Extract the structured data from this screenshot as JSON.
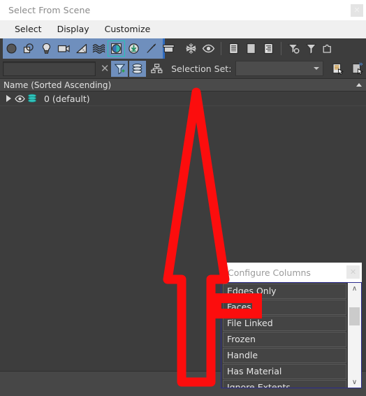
{
  "window": {
    "title": "Select From Scene",
    "close_label": "✕"
  },
  "menubar": {
    "items": [
      {
        "label": "Select"
      },
      {
        "label": "Display"
      },
      {
        "label": "Customize"
      }
    ]
  },
  "toolbar_primary": {
    "icons": [
      {
        "name": "geometry-icon",
        "selected": false
      },
      {
        "name": "shapes-icon",
        "selected": false
      },
      {
        "name": "lights-icon",
        "selected": false
      },
      {
        "name": "cameras-icon",
        "selected": false
      },
      {
        "name": "helpers-icon",
        "selected": false
      },
      {
        "name": "space-warps-icon",
        "selected": false
      },
      {
        "name": "groups-icon",
        "selected": true
      },
      {
        "name": "xrefs-icon",
        "selected": false
      },
      {
        "name": "bone-objects-icon",
        "selected": false
      },
      {
        "name": "containers-icon",
        "selected": false
      }
    ],
    "state_icons": [
      {
        "name": "frozen-icon"
      },
      {
        "name": "hidden-eye-icon"
      }
    ],
    "view_icons": [
      {
        "name": "display-children-icon"
      },
      {
        "name": "display-influences-icon"
      },
      {
        "name": "expand-all-icon"
      }
    ],
    "filter_icons": [
      {
        "name": "selection-filter-icon"
      },
      {
        "name": "filter-icon"
      },
      {
        "name": "container-filter-icon"
      }
    ]
  },
  "toolbar_secondary": {
    "search": {
      "value": "",
      "placeholder": ""
    },
    "clear_label": "✕",
    "find_filter_icon": "find-filter-icon",
    "layers_icon": "layers-icon",
    "hierarchy_icon": "hierarchy-icon",
    "selection_set_label": "Selection Set:",
    "selection_set_value": "",
    "save_set_icon": "save-selection-set-icon",
    "delete_set_icon": "delete-selection-set-icon",
    "overflow_label": "»"
  },
  "list_header": {
    "column_label": "Name (Sorted Ascending)",
    "sort_indicator": "sort-ascending-icon"
  },
  "scene_tree": {
    "rows": [
      {
        "expander": "expand-triangle-icon",
        "visibility_icon": "eye-icon",
        "layer_icon": "layer-icon",
        "label": "0 (default)"
      }
    ]
  },
  "configure_columns": {
    "title": "Configure Columns",
    "close_label": "✕",
    "items": [
      {
        "label": "Edges Only",
        "highlighted": false
      },
      {
        "label": "Faces",
        "highlighted": true
      },
      {
        "label": "File Linked",
        "highlighted": false
      },
      {
        "label": "Frozen",
        "highlighted": false
      },
      {
        "label": "Handle",
        "highlighted": false
      },
      {
        "label": "Has Material",
        "highlighted": false
      },
      {
        "label": "Ignore Extents",
        "highlighted": false
      }
    ],
    "scroll_up_label": "∧",
    "scroll_down_label": "∨"
  },
  "annotations": {
    "arrow": {
      "name": "red-up-arrow-annotation",
      "color": "#fc0d0d"
    },
    "highlight_box": {
      "name": "red-highlight-box-annotation",
      "color": "#fc0d0d",
      "target": "Faces"
    }
  },
  "colors": {
    "accent_blue": "#6f8fbd",
    "selection_teal": "#23c4b8",
    "annotation_red": "#fc0d0d",
    "panel_bg": "#3d3d3d",
    "titlebar_bg": "#ffffff"
  }
}
